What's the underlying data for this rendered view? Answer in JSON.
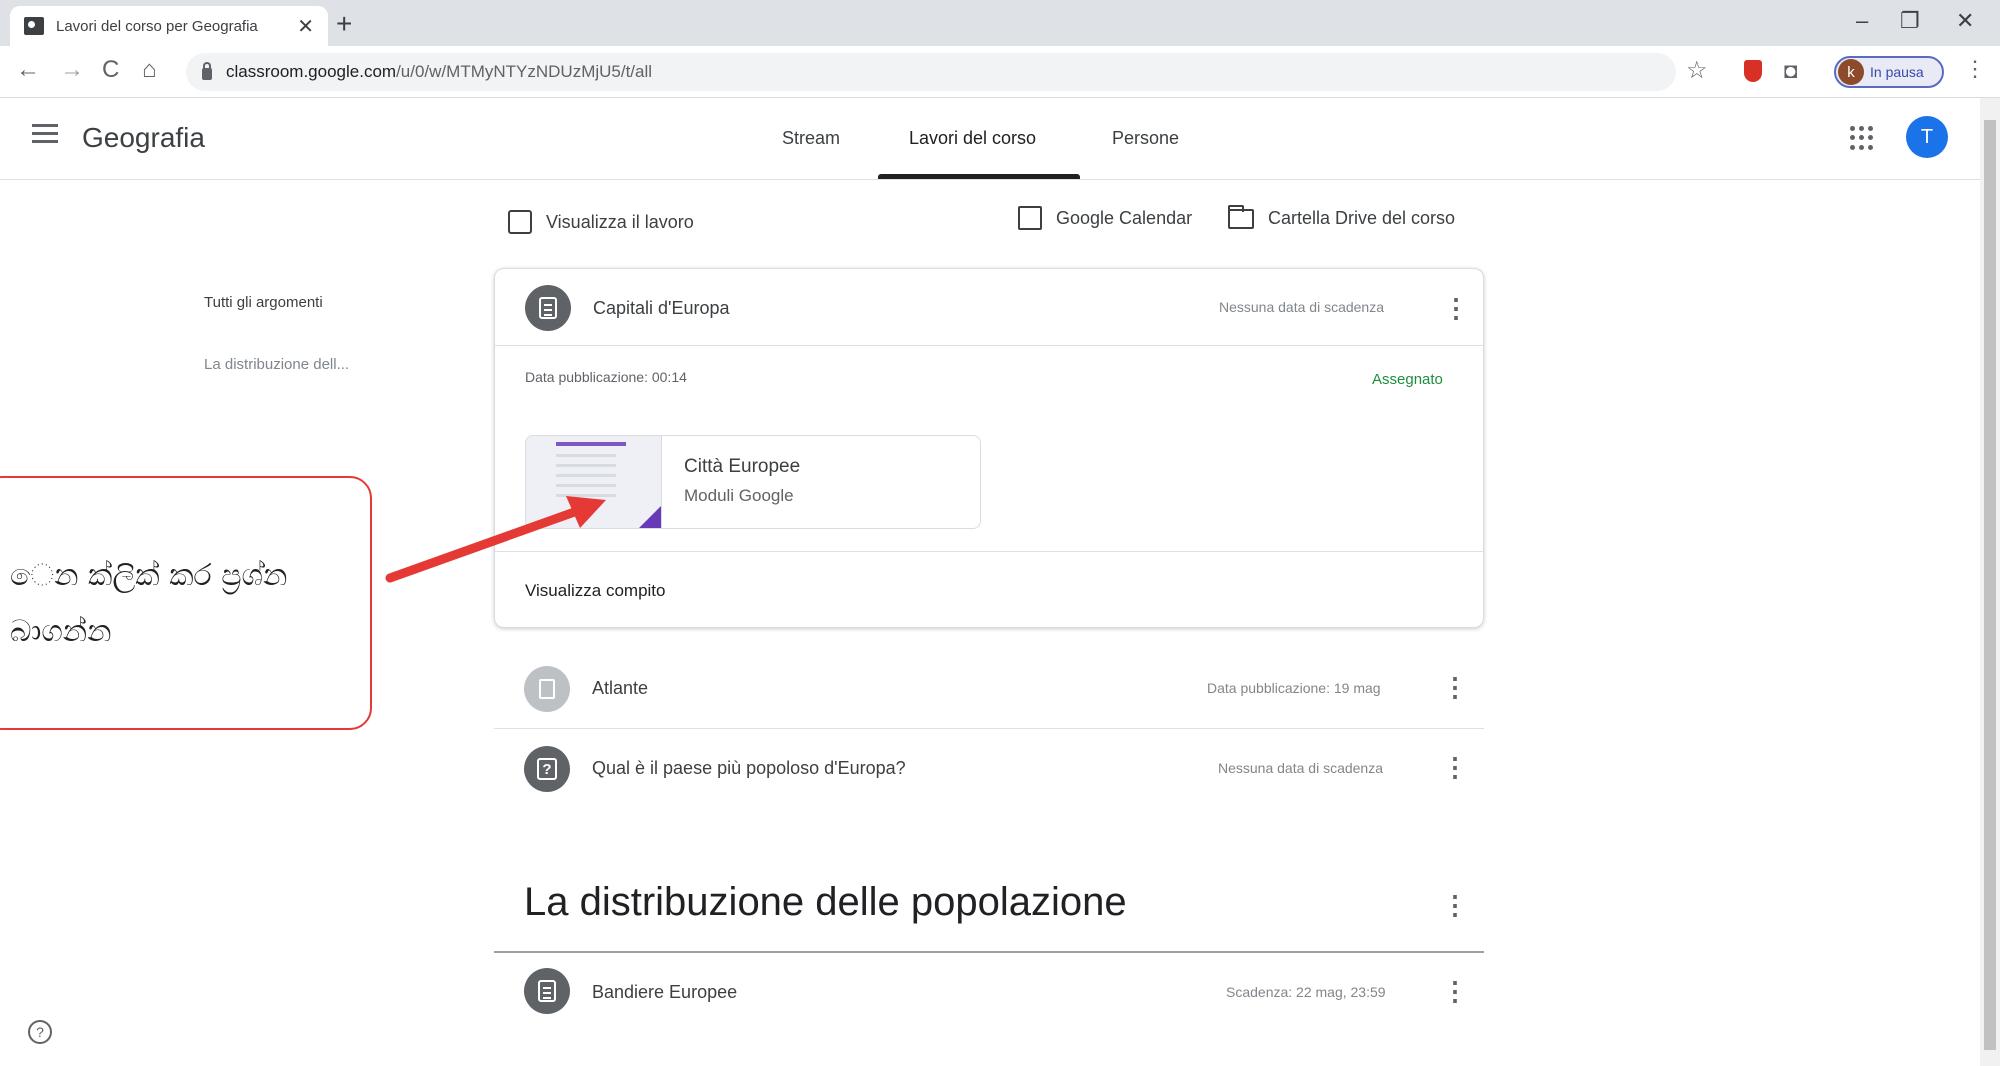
{
  "browser": {
    "tab_title": "Lavori del corso per Geografia",
    "tab_close": "✕",
    "new_tab": "+",
    "window": {
      "minimize": "–",
      "restore": "❐",
      "close": "✕"
    },
    "nav": {
      "back": "←",
      "forward": "→",
      "reload": "C",
      "home": "⌂"
    },
    "url_host": "classroom.google.com",
    "url_path": "/u/0/w/MTMyNTYzNDUzMjU5/t/all",
    "bookmark_star": "☆",
    "camera": "◘",
    "profile_initial": "k",
    "profile_status": "In pausa",
    "menu": "⋮"
  },
  "header": {
    "class_name": "Geografia",
    "tabs": [
      {
        "label": "Stream"
      },
      {
        "label": "Lavori del corso"
      },
      {
        "label": "Persone"
      }
    ],
    "avatar_initial": "T"
  },
  "actions": {
    "view_work": "Visualizza il lavoro",
    "calendar": "Google Calendar",
    "drive_folder": "Cartella Drive del corso"
  },
  "topics": [
    {
      "label": "Tutti gli argomenti"
    },
    {
      "label": "La distribuzione dell..."
    }
  ],
  "expanded_assignment": {
    "title": "Capitali d'Europa",
    "due": "Nessuna data di scadenza",
    "posted": "Data pubblicazione: 00:14",
    "status": "Assegnato",
    "attachment_title": "Città Europee",
    "attachment_type": "Moduli Google",
    "view_link": "Visualizza compito"
  },
  "items": [
    {
      "title": "Atlante",
      "meta": "Data pubblicazione: 19 mag",
      "kind": "material"
    },
    {
      "title": "Qual è il paese più popoloso d'Europa?",
      "meta": "Nessuna data di scadenza",
      "kind": "question"
    }
  ],
  "section": {
    "title": "La distribuzione delle popolazione",
    "items": [
      {
        "title": "Bandiere Europee",
        "meta": "Scadenza: 22 mag, 23:59",
        "kind": "assignment"
      }
    ]
  },
  "help": "?",
  "annotation": {
    "line1": "ෙන ක්ලික් කර ප්‍රශ්න",
    "line2": "බාගන්න"
  },
  "colors": {
    "status_green": "#1e8e3e",
    "annotation_red": "#e53935",
    "forms_purple": "#673ab7",
    "avatar_blue": "#1a73e8"
  }
}
